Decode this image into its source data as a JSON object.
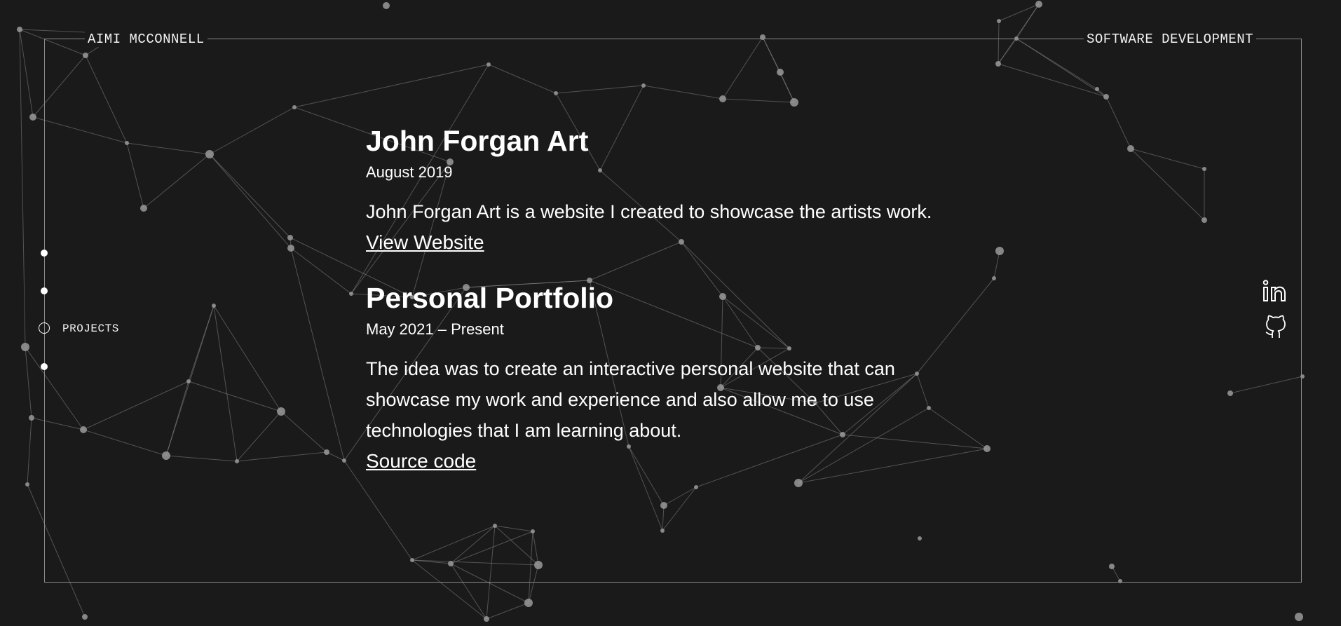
{
  "header": {
    "owner_name": "AIMI MCCONNELL",
    "role": "SOFTWARE DEVELOPMENT"
  },
  "nav": {
    "active_label": "PROJECTS"
  },
  "projects": [
    {
      "title": "John Forgan Art",
      "date": "August 2019",
      "description": "John Forgan Art is a website I created to showcase the artists work.",
      "link_label": "View Website"
    },
    {
      "title": "Personal Portfolio",
      "date": "May 2021 – Present",
      "description": "The idea was to create an interactive personal website that can showcase my work and experience and also allow me to use technologies that I am learning about.",
      "link_label": "Source code"
    }
  ],
  "social": {
    "icons": [
      "linkedin-icon",
      "github-icon"
    ]
  },
  "colors": {
    "background": "#1a1a1a",
    "text": "#ffffff",
    "frame": "#8a8a8a",
    "network": "#9a9a9a"
  }
}
